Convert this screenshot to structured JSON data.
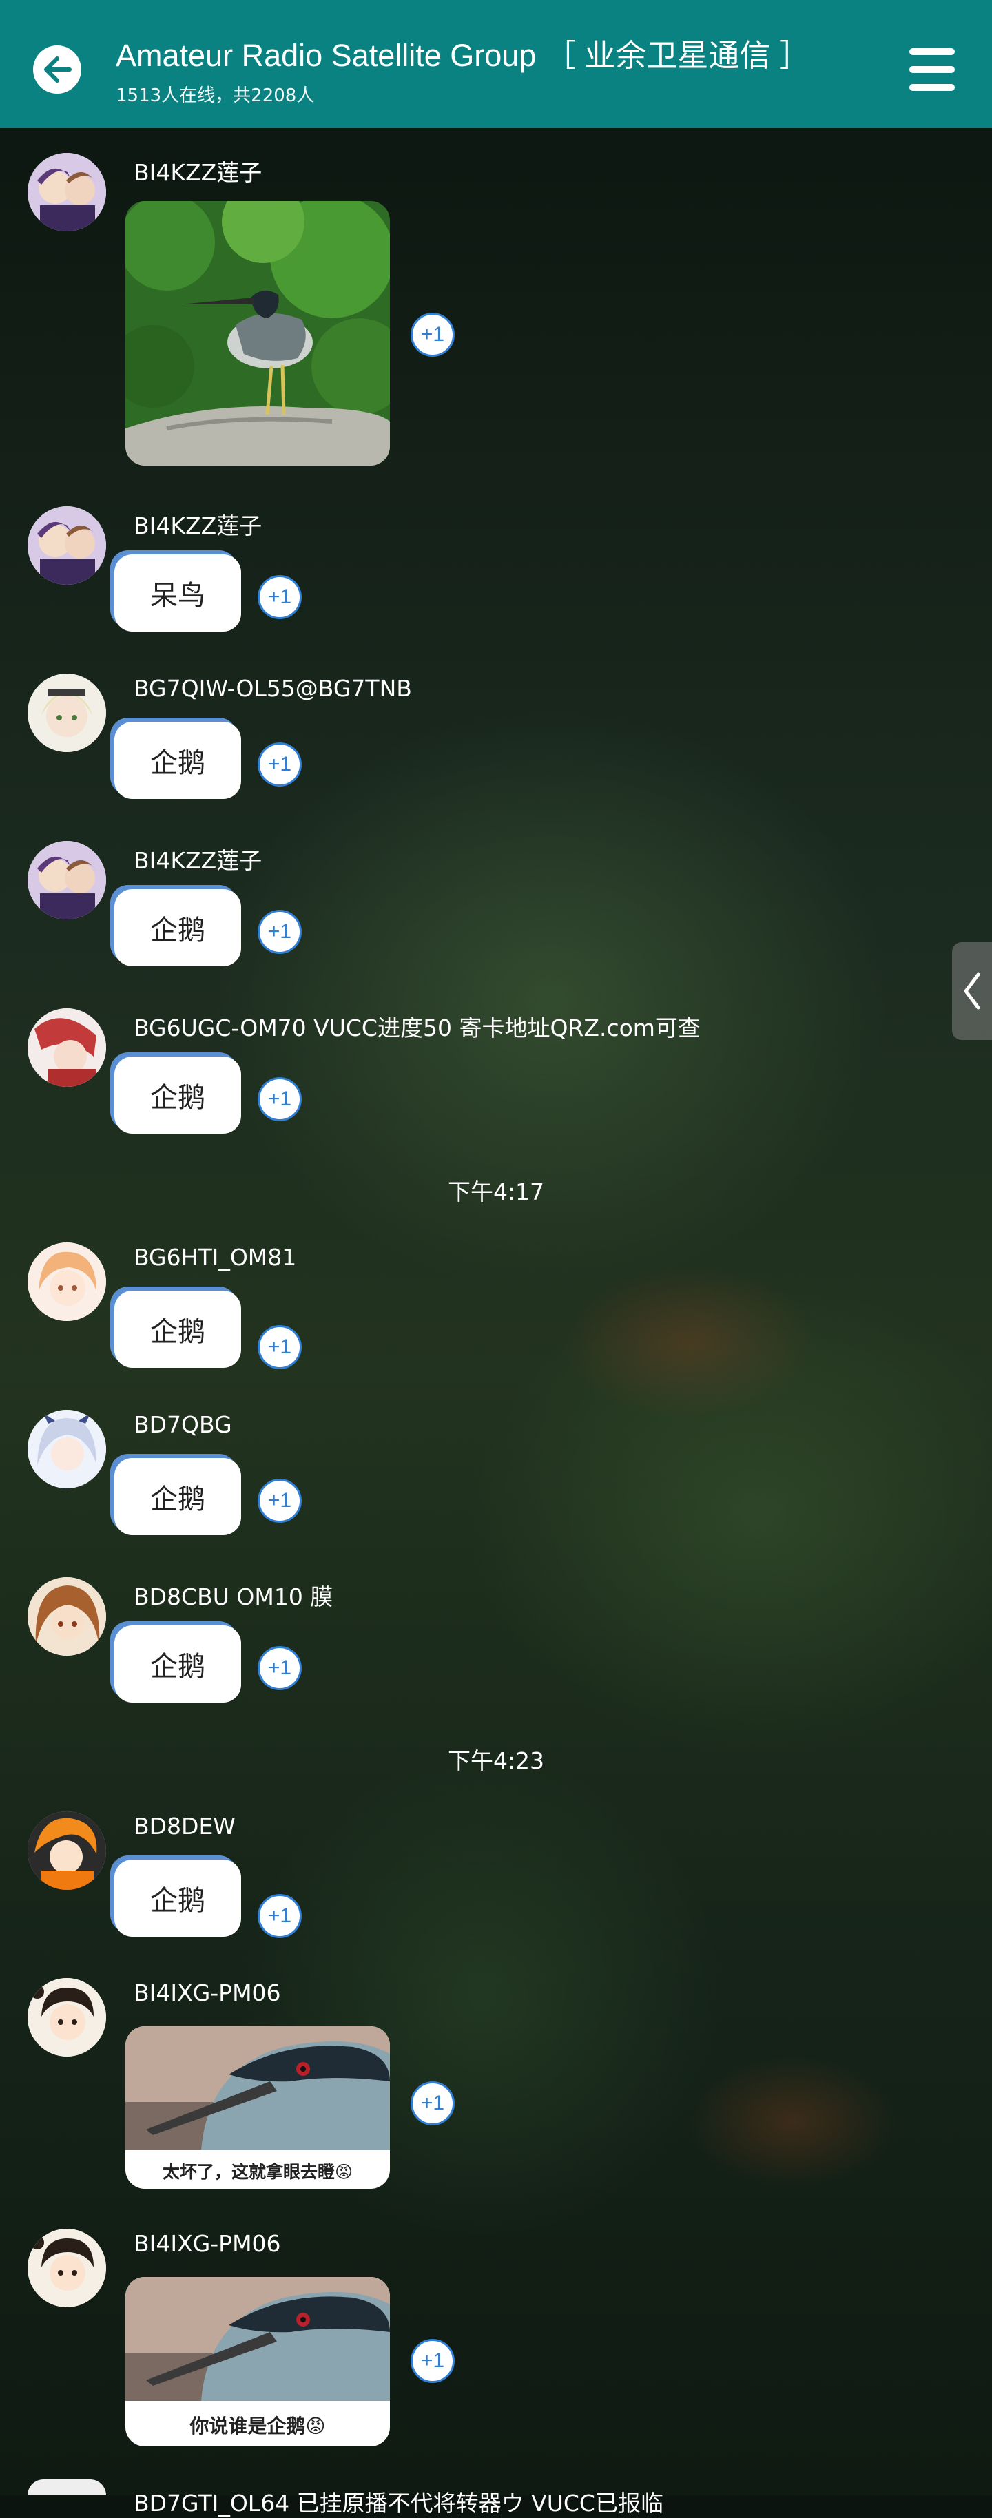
{
  "header": {
    "title": "Amateur Radio Satellite Group ［ 业余卫星通信 ］",
    "subtitle": "1513人在线，共2208人",
    "back_icon": "arrow-left-icon",
    "menu_icon": "menu-icon"
  },
  "plus_label": "+1",
  "messages": [
    {
      "name": "BI4KZZ莲子",
      "type": "image",
      "image": "heron-photo"
    },
    {
      "name": "BI4KZZ莲子",
      "type": "text",
      "text": "呆鸟"
    },
    {
      "name": "BG7QIW-OL55@BG7TNB",
      "type": "text",
      "text": "企鹅"
    },
    {
      "name": "BI4KZZ莲子",
      "type": "text",
      "text": "企鹅"
    },
    {
      "name": "BG6UGC-OM70 VUCC进度50 寄卡地址QRZ.com可查",
      "type": "text",
      "text": "企鹅"
    },
    {
      "name": "BG6HTI_OM81",
      "type": "text",
      "text": "企鹅"
    },
    {
      "name": "BD7QBG",
      "type": "text",
      "text": "企鹅"
    },
    {
      "name": "BD8CBU OM10 膜",
      "type": "text",
      "text": "企鹅"
    },
    {
      "name": "BD8DEW",
      "type": "text",
      "text": "企鹅"
    },
    {
      "name": "BI4IXG-PM06",
      "type": "sticker",
      "caption": "太坏了，这就拿眼去瞪😡"
    },
    {
      "name": "BI4IXG-PM06",
      "type": "sticker",
      "caption": "你说谁是企鹅😡"
    }
  ],
  "timestamps": [
    "下午4:17",
    "下午4:23"
  ],
  "partial_last_name": "BD7GTI_OL64 已挂原播不代将转器ウ VUCC已报临",
  "side_tab_icon": "chevron-left-icon",
  "colors": {
    "header": "#0b8282",
    "plus_border": "#2f7fd6",
    "bubble_accent": "#5b8fd3"
  }
}
